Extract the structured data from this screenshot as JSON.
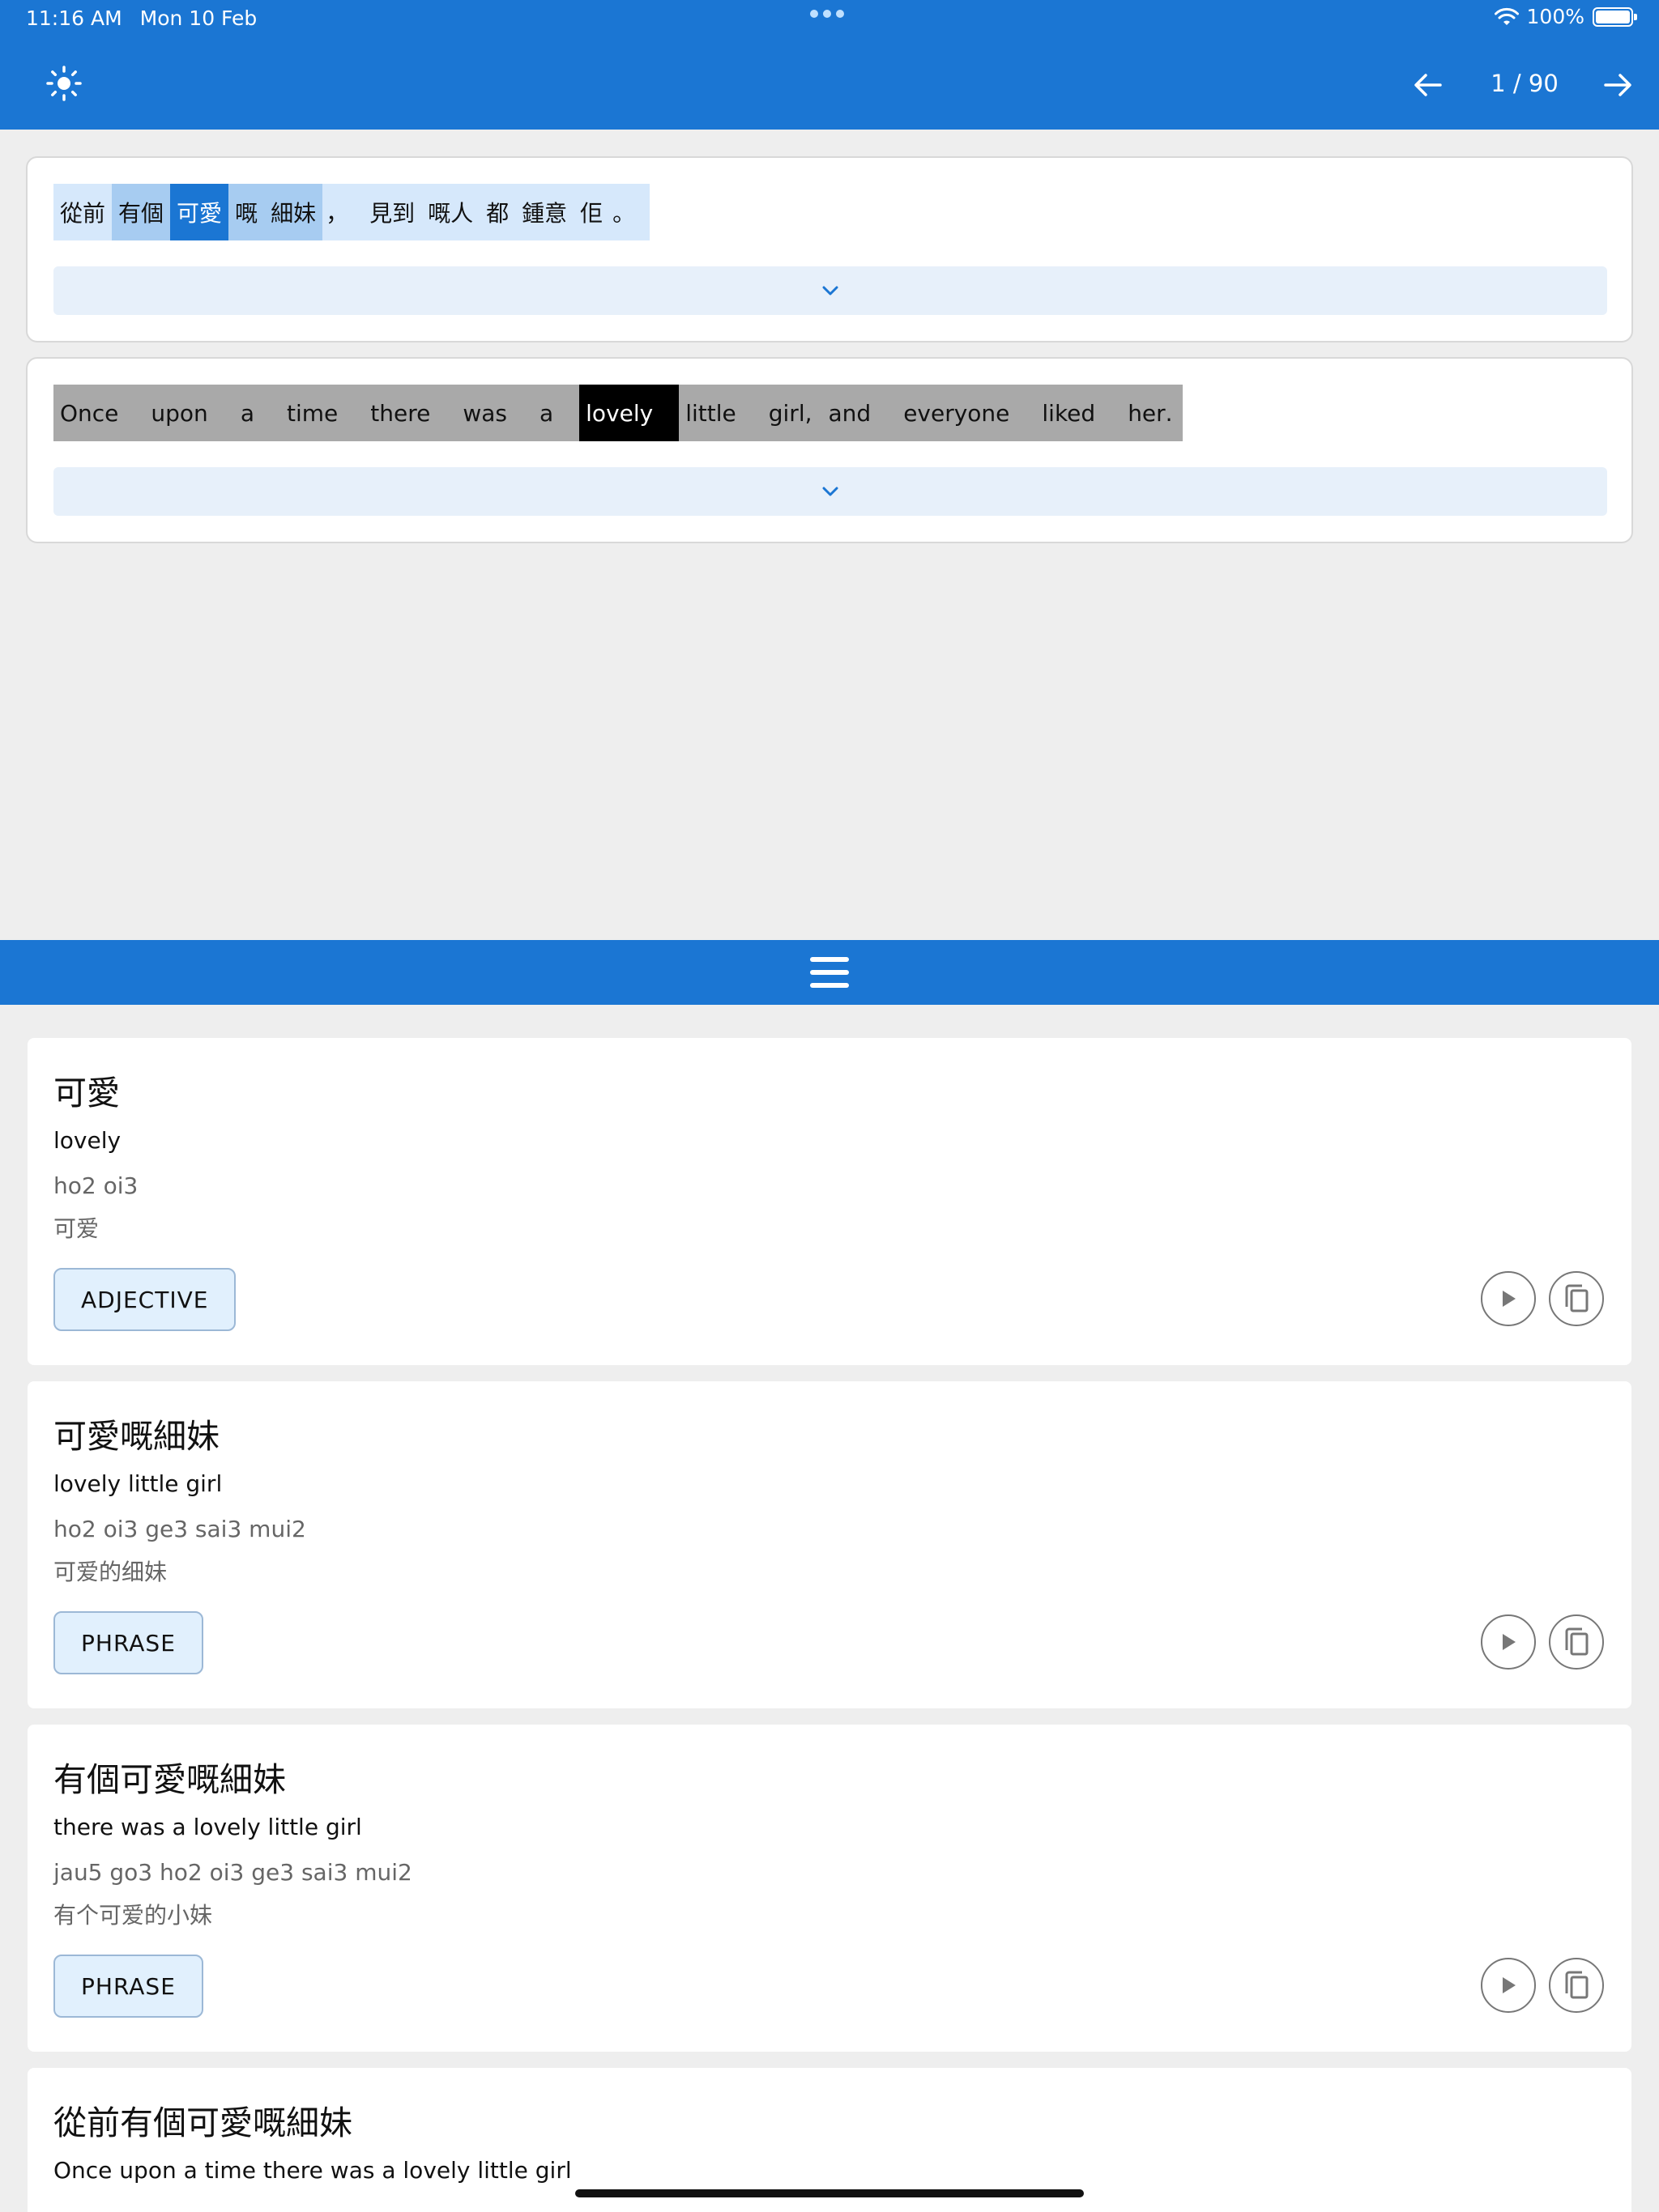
{
  "status_bar": {
    "time": "11:16 AM",
    "date": "Mon 10 Feb",
    "battery": "100%",
    "battery_level": 1.0
  },
  "toolbar": {
    "theme_icon": "sun-icon",
    "prev_icon": "arrow-left-icon",
    "next_icon": "arrow-right-icon",
    "page_counter": "1 / 90"
  },
  "sentence_zh": {
    "tokens": [
      "從前",
      "有個",
      "可愛",
      "嘅",
      "細妹",
      "，",
      "見到",
      "嘅人",
      "都",
      "鍾意",
      "佢",
      "。"
    ],
    "active_index": 2
  },
  "sentence_en": {
    "tokens": [
      "Once",
      "upon",
      "a",
      "time",
      "there",
      "was",
      "a",
      "lovely",
      "little",
      "girl",
      ",",
      "and",
      "everyone",
      "liked",
      "her",
      "."
    ],
    "active_index": 7
  },
  "colors": {
    "primary": "#1b76d3",
    "zh_light": "#d6e8fb",
    "zh_mid": "#a7ccf1",
    "en_token": "#a9a9a9",
    "chip_bg": "#e1f0fd"
  },
  "definitions": [
    {
      "headword": "可愛",
      "meaning": "lovely",
      "jyutping": "ho2 oi3",
      "simplified": "可爱",
      "pos": "ADJECTIVE"
    },
    {
      "headword": "可愛嘅細妹",
      "meaning": "lovely little girl",
      "jyutping": "ho2 oi3 ge3 sai3 mui2",
      "simplified": "可爱的细妹",
      "pos": "PHRASE"
    },
    {
      "headword": "有個可愛嘅細妹",
      "meaning": "there was a lovely little girl",
      "jyutping": "jau5 go3 ho2 oi3 ge3 sai3 mui2",
      "simplified": "有个可爱的小妹",
      "pos": "PHRASE"
    },
    {
      "headword": "從前有個可愛嘅細妹",
      "meaning": "Once upon a time there was a lovely little girl"
    }
  ]
}
